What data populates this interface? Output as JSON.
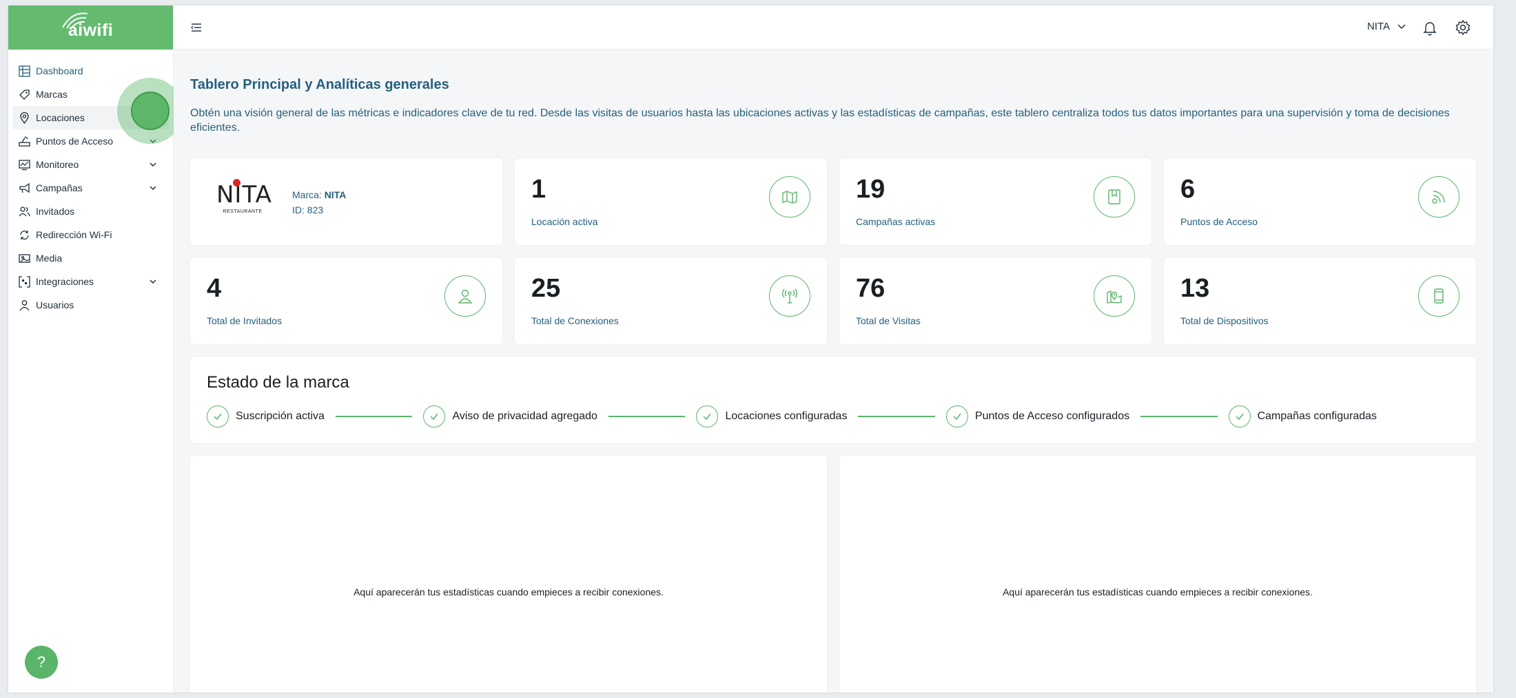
{
  "app": {
    "logo_text": "aiwifi",
    "colors": {
      "accent": "#64bb70",
      "primary_text": "#245f7e",
      "background": "#f5f6f7"
    }
  },
  "sidebar": {
    "items": [
      {
        "label": "Dashboard",
        "icon": "dashboard-icon",
        "active": true
      },
      {
        "label": "Marcas",
        "icon": "tag-icon"
      },
      {
        "label": "Locaciones",
        "icon": "location-pin-icon",
        "has_submenu": true
      },
      {
        "label": "Puntos de Acceso",
        "icon": "router-icon",
        "has_submenu": true
      },
      {
        "label": "Monitoreo",
        "icon": "monitor-icon",
        "has_submenu": true
      },
      {
        "label": "Campañas",
        "icon": "megaphone-icon",
        "has_submenu": true
      },
      {
        "label": "Invitados",
        "icon": "users-icon"
      },
      {
        "label": "Redirección Wi-Fi",
        "icon": "redirect-icon"
      },
      {
        "label": "Media",
        "icon": "media-icon"
      },
      {
        "label": "Integraciones",
        "icon": "integrations-icon",
        "has_submenu": true
      },
      {
        "label": "Usuarios",
        "icon": "user-icon"
      }
    ],
    "help_label": "?"
  },
  "topbar": {
    "brand_selected": "NITA"
  },
  "main": {
    "title": "Tablero Principal y Analíticas generales",
    "description": "Obtén una visión general de las métricas e indicadores clave de tu red. Desde las visitas de usuarios hasta las ubicaciones activas y las estadísticas de campañas, este tablero centraliza todos tus datos importantes para una supervisión y toma de decisiones eficientes.",
    "brand_card": {
      "logo_name": "NITA",
      "logo_sub": "RESTAURANTE",
      "brand_prefix": "Marca:",
      "brand_name": "NITA",
      "id_text": "ID: 823"
    },
    "stats": [
      {
        "value": "1",
        "label": "Locación activa",
        "icon": "map-icon"
      },
      {
        "value": "19",
        "label": "Campañas activas",
        "icon": "bookmark-icon"
      },
      {
        "value": "6",
        "label": "Puntos de Acceso",
        "icon": "signal-icon"
      },
      {
        "value": "4",
        "label": "Total de Invitados",
        "icon": "person-icon"
      },
      {
        "value": "25",
        "label": "Total de Conexiones",
        "icon": "antenna-icon"
      },
      {
        "value": "76",
        "label": "Total de Visitas",
        "icon": "map-pin-icon"
      },
      {
        "value": "13",
        "label": "Total de Dispositivos",
        "icon": "phone-icon"
      }
    ],
    "brand_status": {
      "title": "Estado de la marca",
      "steps": [
        "Suscripción activa",
        "Aviso de privacidad agregado",
        "Locaciones configuradas",
        "Puntos de Acceso configurados",
        "Campañas configuradas"
      ]
    },
    "charts": {
      "empty_left": "Aquí aparecerán tus estadísticas cuando empieces a recibir conexiones.",
      "empty_right": "Aquí aparecerán tus estadísticas cuando empieces a recibir conexiones."
    }
  }
}
